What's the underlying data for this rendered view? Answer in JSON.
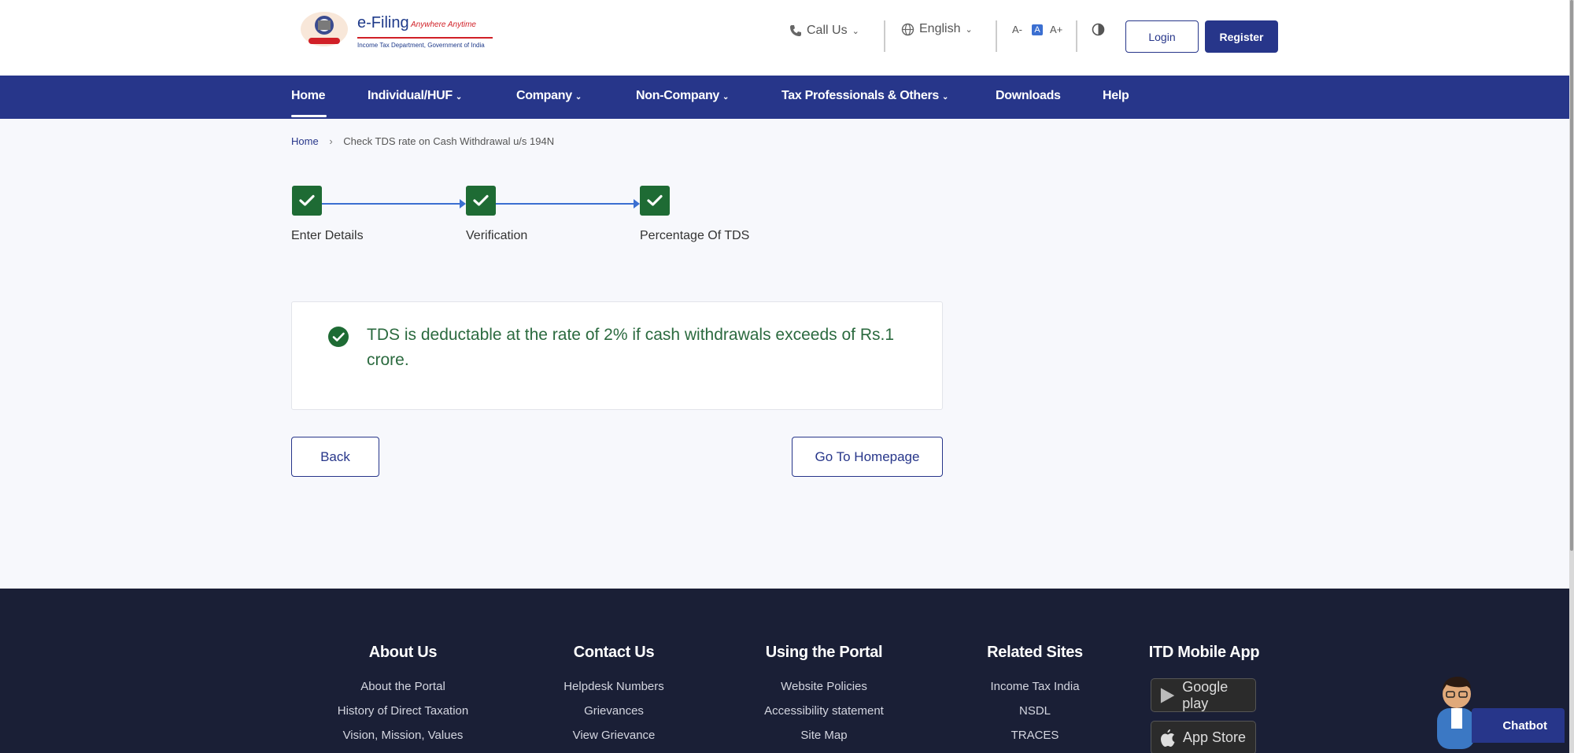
{
  "header": {
    "logo_title": "e-Filing",
    "logo_tagline": "Anywhere Anytime",
    "logo_subtitle": "Income Tax Department, Government of India",
    "call_us": "Call Us",
    "language": "English",
    "font_decrease": "A-",
    "font_normal": "A",
    "font_increase": "A+",
    "login": "Login",
    "register": "Register"
  },
  "nav": {
    "items": [
      {
        "label": "Home"
      },
      {
        "label": "Individual/HUF"
      },
      {
        "label": "Company"
      },
      {
        "label": "Non-Company"
      },
      {
        "label": "Tax Professionals & Others"
      },
      {
        "label": "Downloads"
      },
      {
        "label": "Help"
      }
    ]
  },
  "breadcrumb": {
    "home": "Home",
    "current": "Check TDS rate on Cash Withdrawal u/s 194N"
  },
  "stepper": {
    "steps": [
      {
        "label": "Enter Details"
      },
      {
        "label": "Verification"
      },
      {
        "label": "Percentage Of TDS"
      }
    ]
  },
  "result": {
    "message": "TDS is deductable at the rate of 2% if cash withdrawals exceeds of Rs.1 crore."
  },
  "actions": {
    "back": "Back",
    "go_home": "Go To Homepage"
  },
  "footer": {
    "columns": [
      {
        "title": "About Us",
        "links": [
          "About the Portal",
          "History of Direct Taxation",
          "Vision, Mission, Values"
        ]
      },
      {
        "title": "Contact Us",
        "links": [
          "Helpdesk Numbers",
          "Grievances",
          "View Grievance"
        ]
      },
      {
        "title": "Using the Portal",
        "links": [
          "Website Policies",
          "Accessibility statement",
          "Site Map"
        ]
      },
      {
        "title": "Related Sites",
        "links": [
          "Income Tax India",
          "NSDL",
          "TRACES"
        ]
      }
    ],
    "mobile_app": {
      "title": "ITD Mobile App",
      "google_play": "Google play",
      "app_store": "App Store"
    }
  },
  "chatbot": {
    "label": "Chatbot"
  },
  "colors": {
    "primary": "#27368a",
    "success": "#1e6b34",
    "footer_bg": "#1a1f36"
  }
}
